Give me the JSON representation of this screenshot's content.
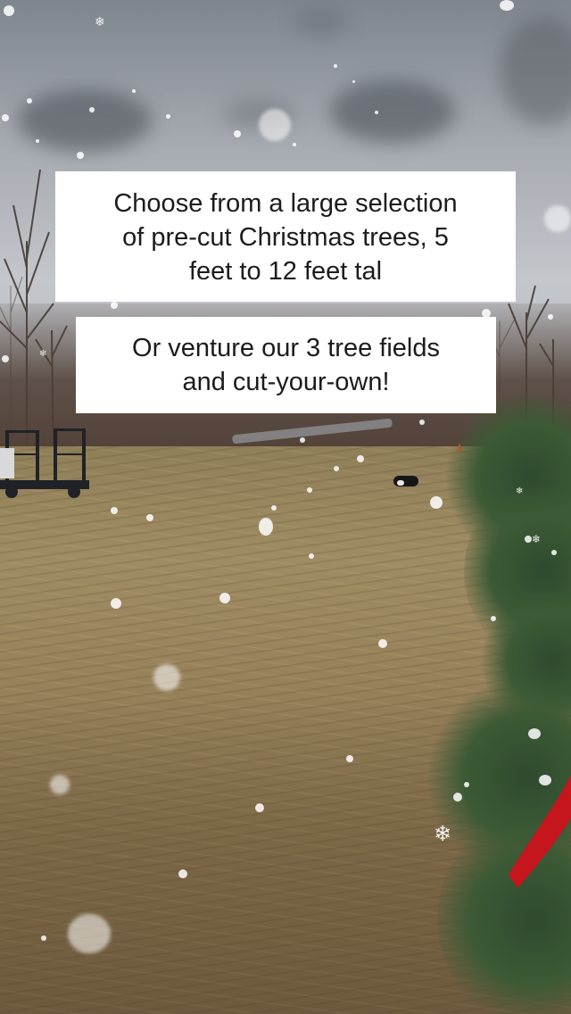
{
  "captions": {
    "primary": {
      "lines": [
        "Choose from a large selection",
        "of pre-cut Christmas trees, 5",
        "feet to 12 feet tal"
      ]
    },
    "secondary": {
      "lines": [
        "Or venture our 3 tree fields",
        "and cut-your-own!"
      ]
    }
  },
  "colors": {
    "caption_background": "#ffffff",
    "caption_text": "#1c1c1c",
    "ribbon": "#c4161c",
    "field": "#9a845c",
    "sky": "#b4b8be"
  },
  "icons": [
    "snowflake-icon"
  ]
}
